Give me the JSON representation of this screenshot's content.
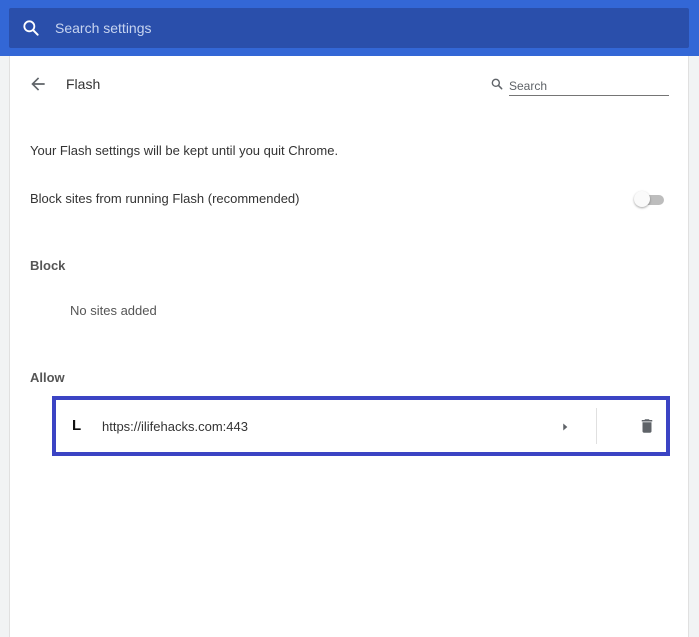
{
  "header": {
    "search_placeholder": "Search settings",
    "search_icon": "search-icon",
    "background_color": "#3367d6"
  },
  "page": {
    "title": "Flash",
    "back_icon": "arrow-back-icon",
    "subpage_search_placeholder": "Search"
  },
  "note": "Your Flash settings will be kept until you quit Chrome.",
  "toggle": {
    "label": "Block sites from running Flash (recommended)",
    "checked": false
  },
  "block": {
    "heading": "Block",
    "empty_text": "No sites added"
  },
  "allow": {
    "heading": "Allow",
    "sites": [
      {
        "favicon_letter": "L",
        "url": "https://ilifehacks.com:443",
        "highlight_color": "#3b44c4"
      }
    ]
  }
}
